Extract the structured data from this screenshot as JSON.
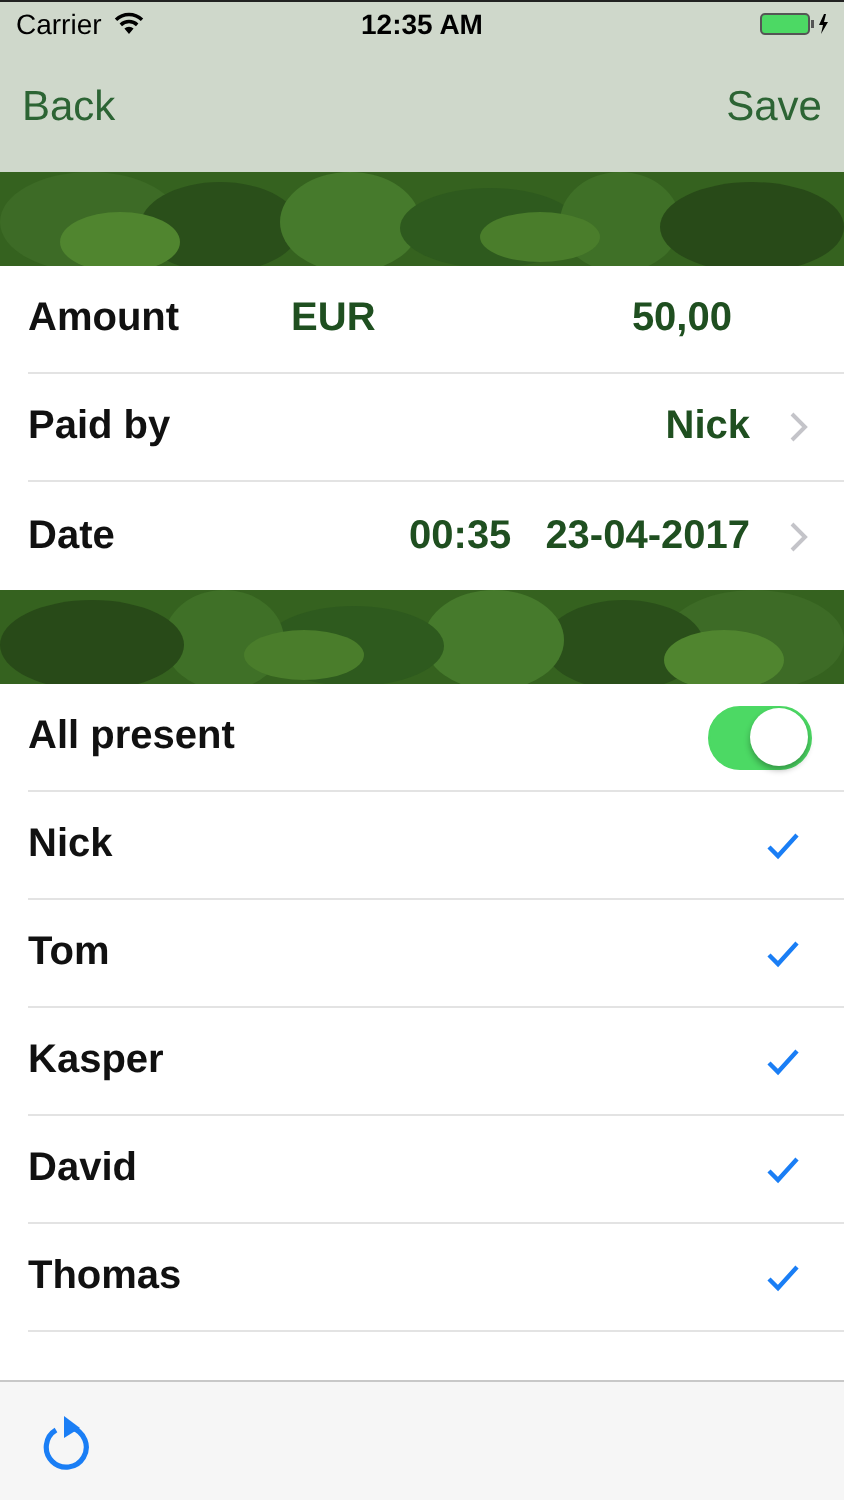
{
  "status_bar": {
    "carrier": "Carrier",
    "time": "12:35 AM"
  },
  "nav": {
    "back": "Back",
    "save": "Save"
  },
  "details": [
    {
      "kind": "amount",
      "label": "Amount",
      "currency": "EUR",
      "value": "50,00"
    },
    {
      "kind": "link",
      "label": "Paid by",
      "value": "Nick"
    },
    {
      "kind": "date",
      "label": "Date",
      "time": "00:35",
      "value": "23-04-2017"
    }
  ],
  "all_present": {
    "label": "All present",
    "on": true
  },
  "people": [
    {
      "name": "Nick",
      "checked": true
    },
    {
      "name": "Tom",
      "checked": true
    },
    {
      "name": "Kasper",
      "checked": true
    },
    {
      "name": "David",
      "checked": true
    },
    {
      "name": "Thomas",
      "checked": true
    }
  ]
}
